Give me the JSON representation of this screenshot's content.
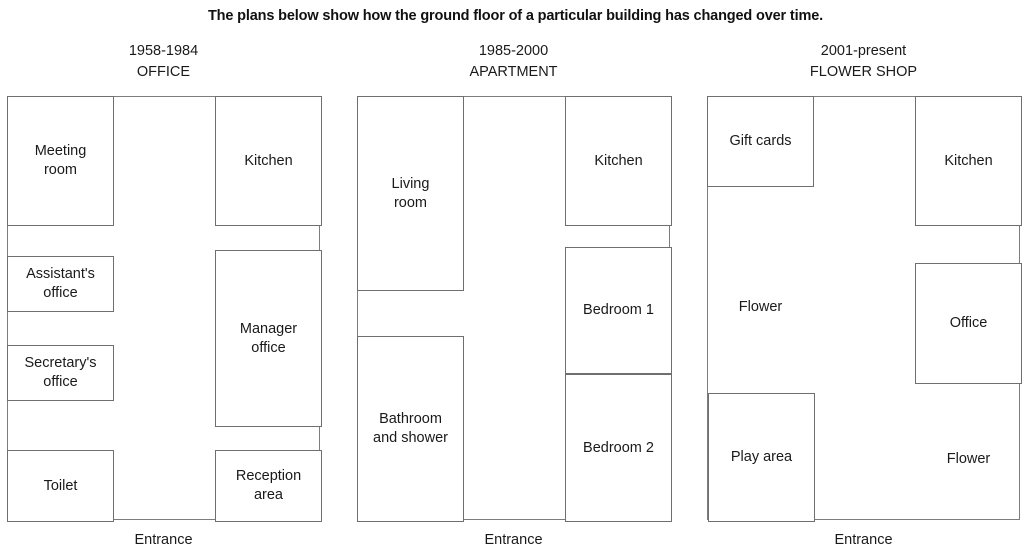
{
  "title": "The plans below show how the ground floor of a particular building has changed over time.",
  "entrance_label": "Entrance",
  "plans": [
    {
      "period": "1958-1984",
      "usage": "OFFICE",
      "rooms": [
        {
          "name": "meeting-room",
          "label": "Meeting\nroom"
        },
        {
          "name": "kitchen",
          "label": "Kitchen"
        },
        {
          "name": "assistants-office",
          "label": "Assistant's\noffice"
        },
        {
          "name": "manager-office",
          "label": "Manager\noffice"
        },
        {
          "name": "secretarys-office",
          "label": "Secretary's\noffice"
        },
        {
          "name": "toilet",
          "label": "Toilet"
        },
        {
          "name": "reception-area",
          "label": "Reception\narea"
        }
      ]
    },
    {
      "period": "1985-2000",
      "usage": "APARTMENT",
      "rooms": [
        {
          "name": "living-room",
          "label": "Living\nroom"
        },
        {
          "name": "kitchen",
          "label": "Kitchen"
        },
        {
          "name": "bedroom-1",
          "label": "Bedroom 1"
        },
        {
          "name": "bathroom-and-shower",
          "label": "Bathroom\nand shower"
        },
        {
          "name": "bedroom-2",
          "label": "Bedroom 2"
        }
      ]
    },
    {
      "period": "2001-present",
      "usage": "FLOWER SHOP",
      "rooms": [
        {
          "name": "gift-cards",
          "label": "Gift cards"
        },
        {
          "name": "kitchen",
          "label": "Kitchen"
        },
        {
          "name": "flower-upper",
          "label": "Flower"
        },
        {
          "name": "office",
          "label": "Office"
        },
        {
          "name": "play-area",
          "label": "Play area"
        },
        {
          "name": "flower-lower",
          "label": "Flower"
        }
      ]
    }
  ]
}
